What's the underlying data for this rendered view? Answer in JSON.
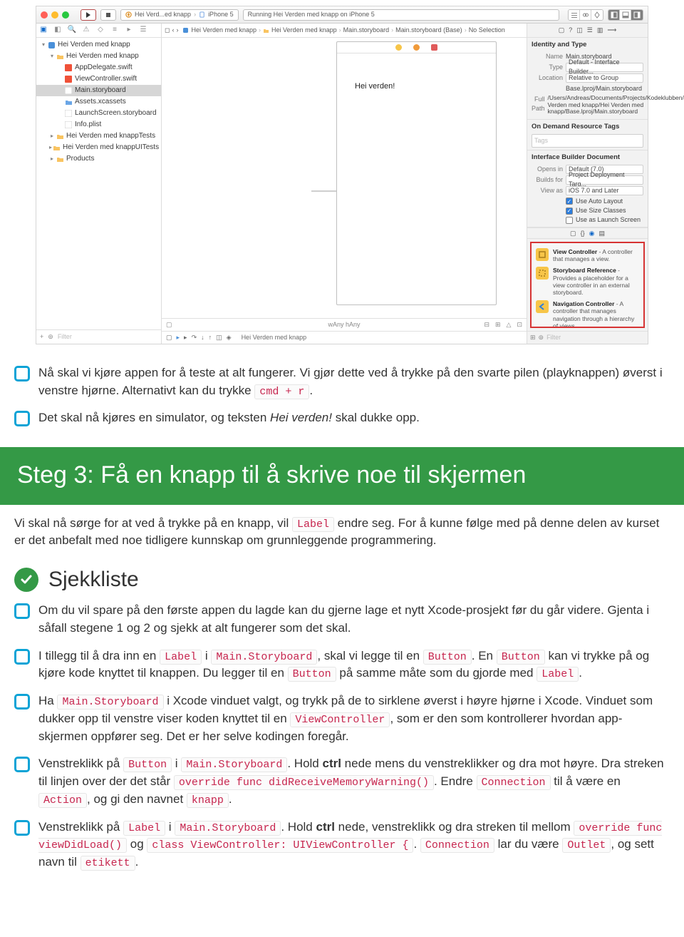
{
  "xcode": {
    "scheme_app": "Hei Verd...ed knapp",
    "scheme_device": "iPhone 5",
    "status": "Running Hei Verden med knapp on iPhone 5",
    "crumbs": [
      "Hei Verden med knapp",
      "Hei Verden med knapp",
      "Main.storyboard",
      "Main.storyboard (Base)",
      "No Selection"
    ],
    "files": {
      "root": "Hei Verden med knapp",
      "group": "Hei Verden med knapp",
      "items": [
        "AppDelegate.swift",
        "ViewController.swift",
        "Main.storyboard",
        "Assets.xcassets",
        "LaunchScreen.storyboard",
        "Info.plist"
      ],
      "tests": "Hei Verden med knappTests",
      "uitests": "Hei Verden med knappUITests",
      "products": "Products"
    },
    "nav_filter": "Filter",
    "canvas": {
      "label": "Hei verden!",
      "size": "wAny hAny"
    },
    "debug": "Hei Verden med knapp",
    "inspector": {
      "identity_title": "Identity and Type",
      "name_label": "Name",
      "name_val": "Main.storyboard",
      "type_label": "Type",
      "type_val": "Default - Interface Builder...",
      "location_label": "Location",
      "location_val": "Relative to Group",
      "location_sub": "Base.lproj/Main.storyboard",
      "fullpath_label": "Full Path",
      "fullpath_val": "/Users/Andreas/Documents/Projects/Kodeklubben/Hei Verden med knapp/Hei Verden med knapp/Base.lproj/Main.storyboard",
      "tags_title": "On Demand Resource Tags",
      "tags_placeholder": "Tags",
      "ib_title": "Interface Builder Document",
      "opens_label": "Opens in",
      "opens_val": "Default (7.0)",
      "builds_label": "Builds for",
      "builds_val": "Project Deployment Targ...",
      "view_label": "View as",
      "view_val": "iOS 7.0 and Later",
      "autolayout": "Use Auto Layout",
      "sizeclasses": "Use Size Classes",
      "launch": "Use as Launch Screen",
      "lib": {
        "vc_title": "View Controller",
        "vc_desc": " - A controller that manages a view.",
        "sr_title": "Storyboard Reference",
        "sr_desc": " - Provides a placeholder for a view controller in an external storyboard.",
        "nc_title": "Navigation Controller",
        "nc_desc": " - A controller that manages navigation through a hierarchy of views."
      },
      "filter": "Filter"
    }
  },
  "doc": {
    "c1a": "Nå skal vi kjøre appen for å teste at alt fungerer. Vi gjør dette ved å trykke på den svarte pilen (playknappen) øverst i venstre hjørne. Alternativt kan du trykke ",
    "c1b": "cmd + r",
    "c1c": ".",
    "c2a": "Det skal nå kjøres en simulator, og teksten ",
    "c2b": "Hei verden!",
    "c2c": " skal dukke opp.",
    "step_title": "Steg 3: Få en knapp til å skrive noe til skjermen",
    "intro_a": "Vi skal nå sørge for at ved å trykke på en knapp, vil ",
    "intro_code": "Label",
    "intro_b": " endre seg. For å kunne følge med på denne delen av kurset er det anbefalt med noe tidligere kunnskap om grunnleggende programmering.",
    "sjekkliste": "Sjekkliste",
    "sc1": "Om du vil spare på den første appen du lagde kan du gjerne lage et nytt Xcode-prosjekt før du går videre. Gjenta i såfall stegene 1 og 2 og sjekk at alt fungerer som det skal.",
    "sc2a": "I tillegg til å dra inn en ",
    "label": "Label",
    "sc2b": " i ",
    "mainsb": "Main.Storyboard",
    "sc2c": ", skal vi legge til en ",
    "button": "Button",
    "sc2d": ". En ",
    "sc2e": " kan vi trykke på og kjøre kode knyttet til knappen. Du legger til en ",
    "sc2f": " på samme måte som du gjorde med ",
    "sc2g": ".",
    "sc3a": "Ha ",
    "sc3b": " i Xcode vinduet valgt, og trykk på de to sirklene øverst i høyre hjørne i Xcode. Vinduet som dukker opp til venstre viser koden knyttet til en ",
    "viewctrl": "ViewController",
    "sc3c": ", som er den som kontrollerer hvordan app-skjermen oppfører seg. Det er her selve kodingen foregår.",
    "sc4a": "Venstreklikk på ",
    "sc4b": " i ",
    "sc4c": ". Hold ",
    "ctrl": "ctrl",
    "sc4d": " nede mens du venstreklikker og dra mot høyre. Dra streken til linjen over der det står ",
    "override": "override func didReceiveMemoryWarning()",
    "sc4e": ". Endre ",
    "connection": "Connection",
    "sc4f": " til å være en ",
    "action": "Action",
    "sc4g": ", og gi den navnet ",
    "knapp": "knapp",
    "sc4h": ".",
    "sc5a": "Venstreklikk på ",
    "sc5b": " i ",
    "sc5c": ". Hold ",
    "sc5d": " nede, venstreklikk og dra streken til mellom ",
    "viewdidload": "override func viewDidLoad()",
    "sc5e": " og ",
    "classdecl": "class ViewController: UIViewController {",
    "sc5f": ". ",
    "sc5g": " lar du være ",
    "outlet": "Outlet",
    "sc5h": ", og sett navn til ",
    "etikett": "etikett",
    "sc5i": "."
  }
}
